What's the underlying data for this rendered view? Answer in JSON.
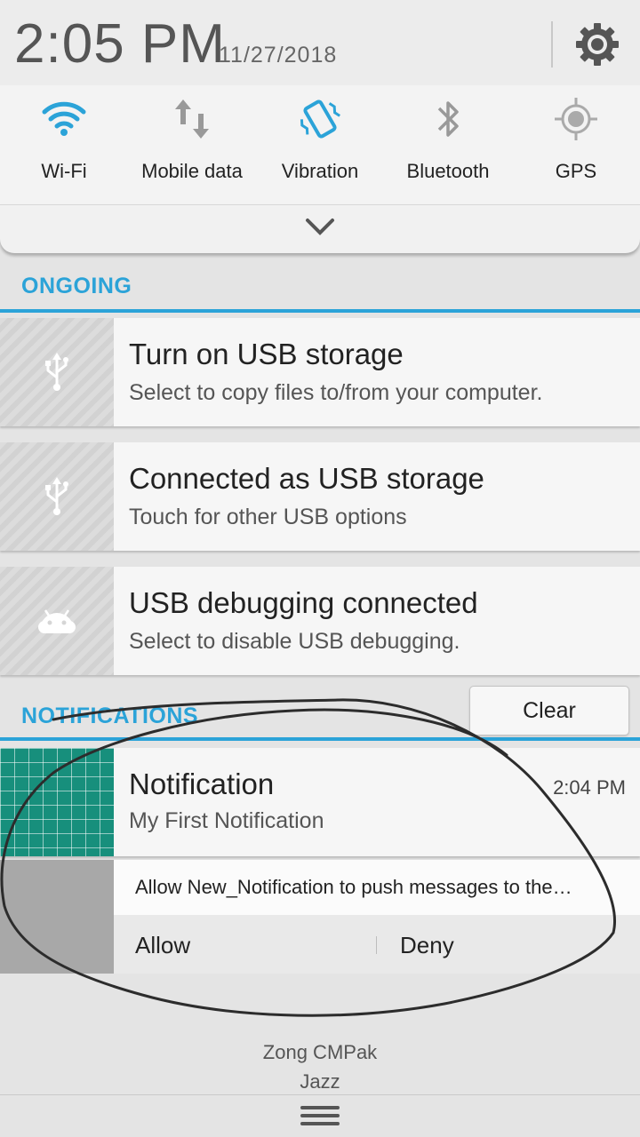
{
  "header": {
    "time": "2:05 PM",
    "date": "11/27/2018",
    "settings_icon": "gear-icon"
  },
  "quick_settings": [
    {
      "label": "Wi-Fi",
      "icon": "wifi-icon",
      "active": true
    },
    {
      "label": "Mobile data",
      "icon": "mobile-data-icon",
      "active": false
    },
    {
      "label": "Vibration",
      "icon": "vibration-icon",
      "active": true
    },
    {
      "label": "Bluetooth",
      "icon": "bluetooth-icon",
      "active": false
    },
    {
      "label": "GPS",
      "icon": "gps-icon",
      "active": false
    }
  ],
  "expand_icon": "chevron-down-icon",
  "ongoing": {
    "title": "ONGOING",
    "items": [
      {
        "title": "Turn on USB storage",
        "subtitle": "Select to copy files to/from your computer.",
        "icon": "usb-icon"
      },
      {
        "title": "Connected as USB storage",
        "subtitle": "Touch for other USB options",
        "icon": "usb-icon"
      },
      {
        "title": "USB debugging connected",
        "subtitle": "Select to disable USB debugging.",
        "icon": "android-icon"
      }
    ]
  },
  "notifications": {
    "title": "NOTIFICATIONS",
    "clear_label": "Clear",
    "items": [
      {
        "title": "Notification",
        "subtitle": "My First Notification",
        "time": "2:04 PM"
      }
    ],
    "permission": {
      "text": "Allow New_Notification to push messages to the…",
      "allow_label": "Allow",
      "deny_label": "Deny"
    }
  },
  "carrier": {
    "line1": "Zong CMPak",
    "line2": "Jazz"
  },
  "colors": {
    "accent": "#2ba3d8",
    "notif_thumb": "#178f7c",
    "background": "#e4e4e4"
  }
}
